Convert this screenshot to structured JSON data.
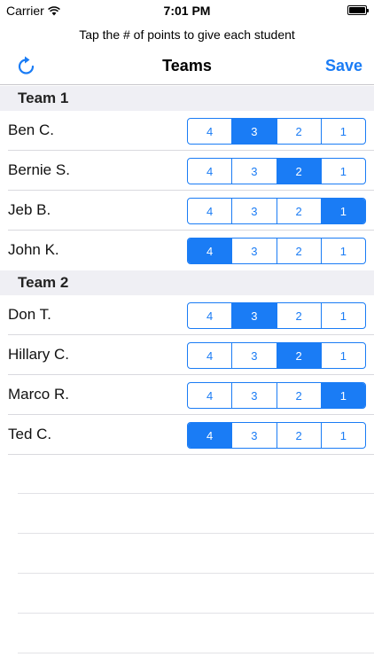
{
  "status": {
    "carrier": "Carrier",
    "time": "7:01 PM"
  },
  "prompt": "Tap the # of points to give each student",
  "nav": {
    "title": "Teams",
    "save_label": "Save"
  },
  "teams": [
    {
      "name": "Team 1",
      "students": [
        {
          "name": "Ben C.",
          "selected": "3"
        },
        {
          "name": "Bernie S.",
          "selected": "2"
        },
        {
          "name": "Jeb B.",
          "selected": "1"
        },
        {
          "name": "John K.",
          "selected": "4"
        }
      ]
    },
    {
      "name": "Team 2",
      "students": [
        {
          "name": "Don T.",
          "selected": "3"
        },
        {
          "name": "Hillary C.",
          "selected": "2"
        },
        {
          "name": "Marco R.",
          "selected": "1"
        },
        {
          "name": "Ted C.",
          "selected": "4"
        }
      ]
    }
  ],
  "point_options": [
    "4",
    "3",
    "2",
    "1"
  ],
  "colors": {
    "accent": "#1a7cf5",
    "section_bg": "#efeff4"
  }
}
